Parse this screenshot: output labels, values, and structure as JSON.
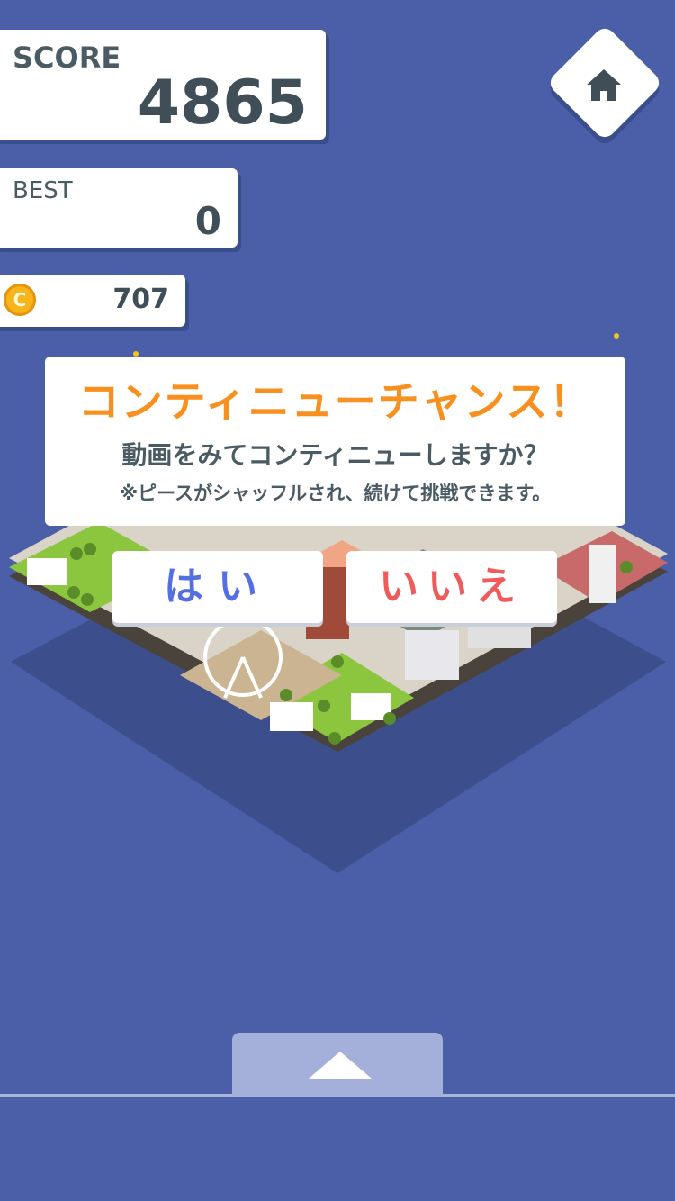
{
  "hud": {
    "score_label": "SCORE",
    "score_value": "4865",
    "best_label": "BEST",
    "best_value": "0",
    "coin_symbol": "C",
    "coins": "707"
  },
  "dialog": {
    "title": "コンティニューチャンス！",
    "message": "動画をみてコンティニューしますか？",
    "note": "※ピースがシャッフルされ、続けて挑戦できます。",
    "yes_label": "はい",
    "no_label": "いいえ"
  },
  "icons": {
    "home": "home-icon",
    "coin": "coin-icon",
    "up": "up-arrow-icon"
  },
  "colors": {
    "background": "#4a5fa8",
    "title": "#f7901e",
    "yes": "#5470e0",
    "no": "#f05a5a"
  }
}
